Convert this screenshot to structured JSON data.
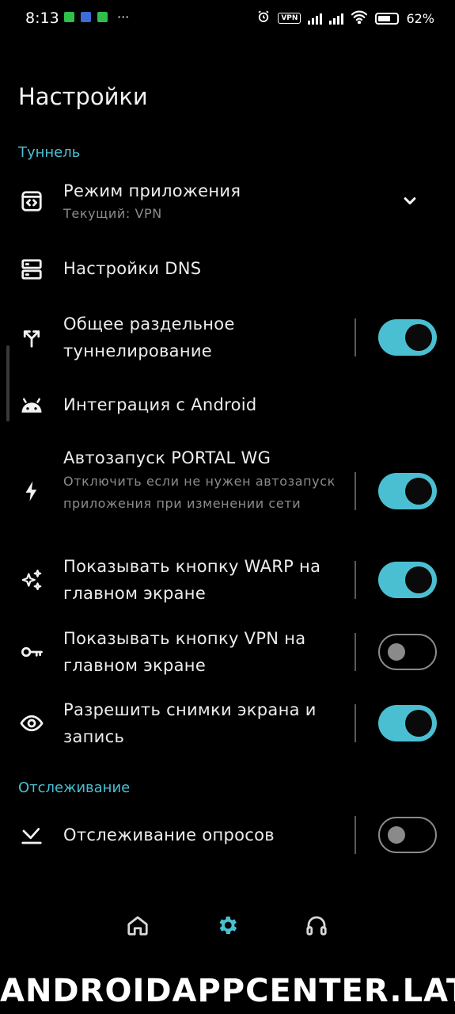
{
  "status_bar": {
    "time": "8:13",
    "dots": "···",
    "vpn": "VPN",
    "battery": "62%"
  },
  "title": "Настройки",
  "sections": {
    "tunnel": "Туннель",
    "tracking": "Отслеживание"
  },
  "items": {
    "app_mode": {
      "title": "Режим приложения",
      "subtitle": "Текущий: VPN",
      "icon": "code-window-icon"
    },
    "dns": {
      "title": "Настройки DNS",
      "icon": "server-icon"
    },
    "split_tunnel": {
      "title": "Общее раздельное туннелирование",
      "toggle": true,
      "icon": "split-arrows-icon"
    },
    "android": {
      "title": "Интеграция с Android",
      "icon": "android-icon"
    },
    "autostart": {
      "title": "Автозапуск PORTAL WG",
      "subtitle": "Отключить если не нужен автозапуск приложения при изменении сети",
      "toggle": true,
      "icon": "bolt-icon"
    },
    "warp_button": {
      "title": "Показывать кнопку WARP на главном экране",
      "toggle": true,
      "icon": "sparkle-icon"
    },
    "vpn_button": {
      "title": "Показывать кнопку VPN на главном экране",
      "toggle": false,
      "icon": "key-icon"
    },
    "screenshots": {
      "title": "Разрешить снимки экрана и запись",
      "toggle": true,
      "icon": "eye-icon"
    },
    "poll_tracking": {
      "title": "Отслеживание опросов",
      "toggle": false,
      "icon": "poll-icon"
    }
  },
  "bottom_nav": [
    {
      "name": "home",
      "icon": "home-icon",
      "active": false
    },
    {
      "name": "settings",
      "icon": "gear-icon",
      "active": true
    },
    {
      "name": "support",
      "icon": "headphones-icon",
      "active": false
    }
  ],
  "colors": {
    "accent": "#4bbfd2",
    "background": "#000000"
  },
  "watermark": "ANDROIDAPPCENTER.LAT"
}
